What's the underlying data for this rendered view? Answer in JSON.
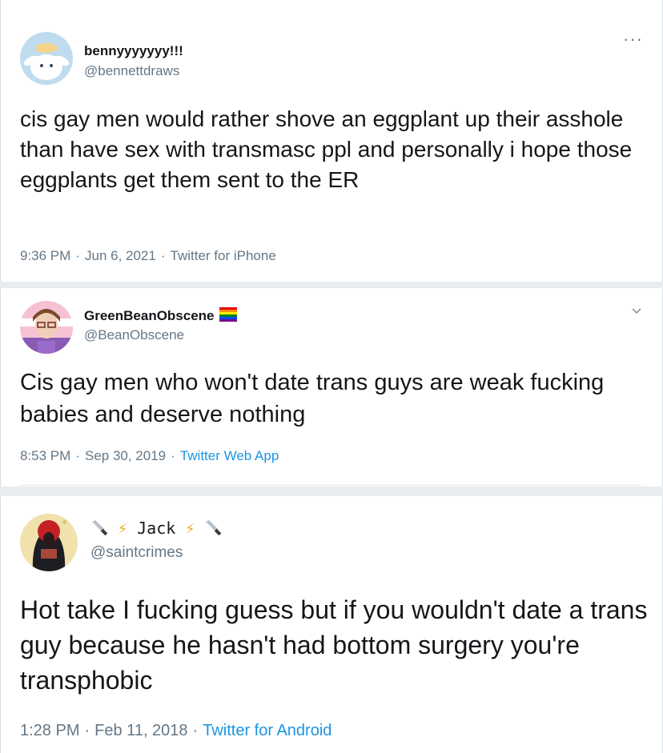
{
  "tweets": [
    {
      "display_name": "bennyyyyyyy!!!",
      "handle": "@bennettdraws",
      "avatar_icon": "cinnamoroll-avatar",
      "text": "cis gay men would rather shove an eggplant up their asshole than have sex with transmasc ppl and personally i hope those eggplants get them sent to the ER",
      "time": "9:36 PM",
      "date": "Jun 6, 2021",
      "source": "Twitter for iPhone",
      "menu_icon": "more-dots-icon"
    },
    {
      "display_name": "GreenBeanObscene",
      "name_emoji": "rainbow-flag-icon",
      "handle": "@BeanObscene",
      "avatar_icon": "drawn-portrait-avatar",
      "text": "Cis gay men who won't date trans guys are weak fucking babies and deserve nothing",
      "time": "8:53 PM",
      "date": "Sep 30, 2019",
      "source": "Twitter Web App",
      "menu_icon": "chevron-down-icon"
    },
    {
      "display_name": "Jack",
      "name_prefix_icons": [
        "knife-icon",
        "lightning-icon"
      ],
      "name_suffix_icons": [
        "lightning-icon",
        "knife-icon"
      ],
      "handle": "@saintcrimes",
      "avatar_icon": "hooded-figure-avatar",
      "text": "Hot take I fucking guess but if you wouldn't date a trans guy because he hasn't had bottom surgery you're transphobic",
      "time": "1:28 PM",
      "date": "Feb 11, 2018",
      "source": "Twitter for Android"
    }
  ],
  "separator": "·",
  "colors": {
    "text": "#14171a",
    "muted": "#657786",
    "link": "#1b95e0"
  }
}
